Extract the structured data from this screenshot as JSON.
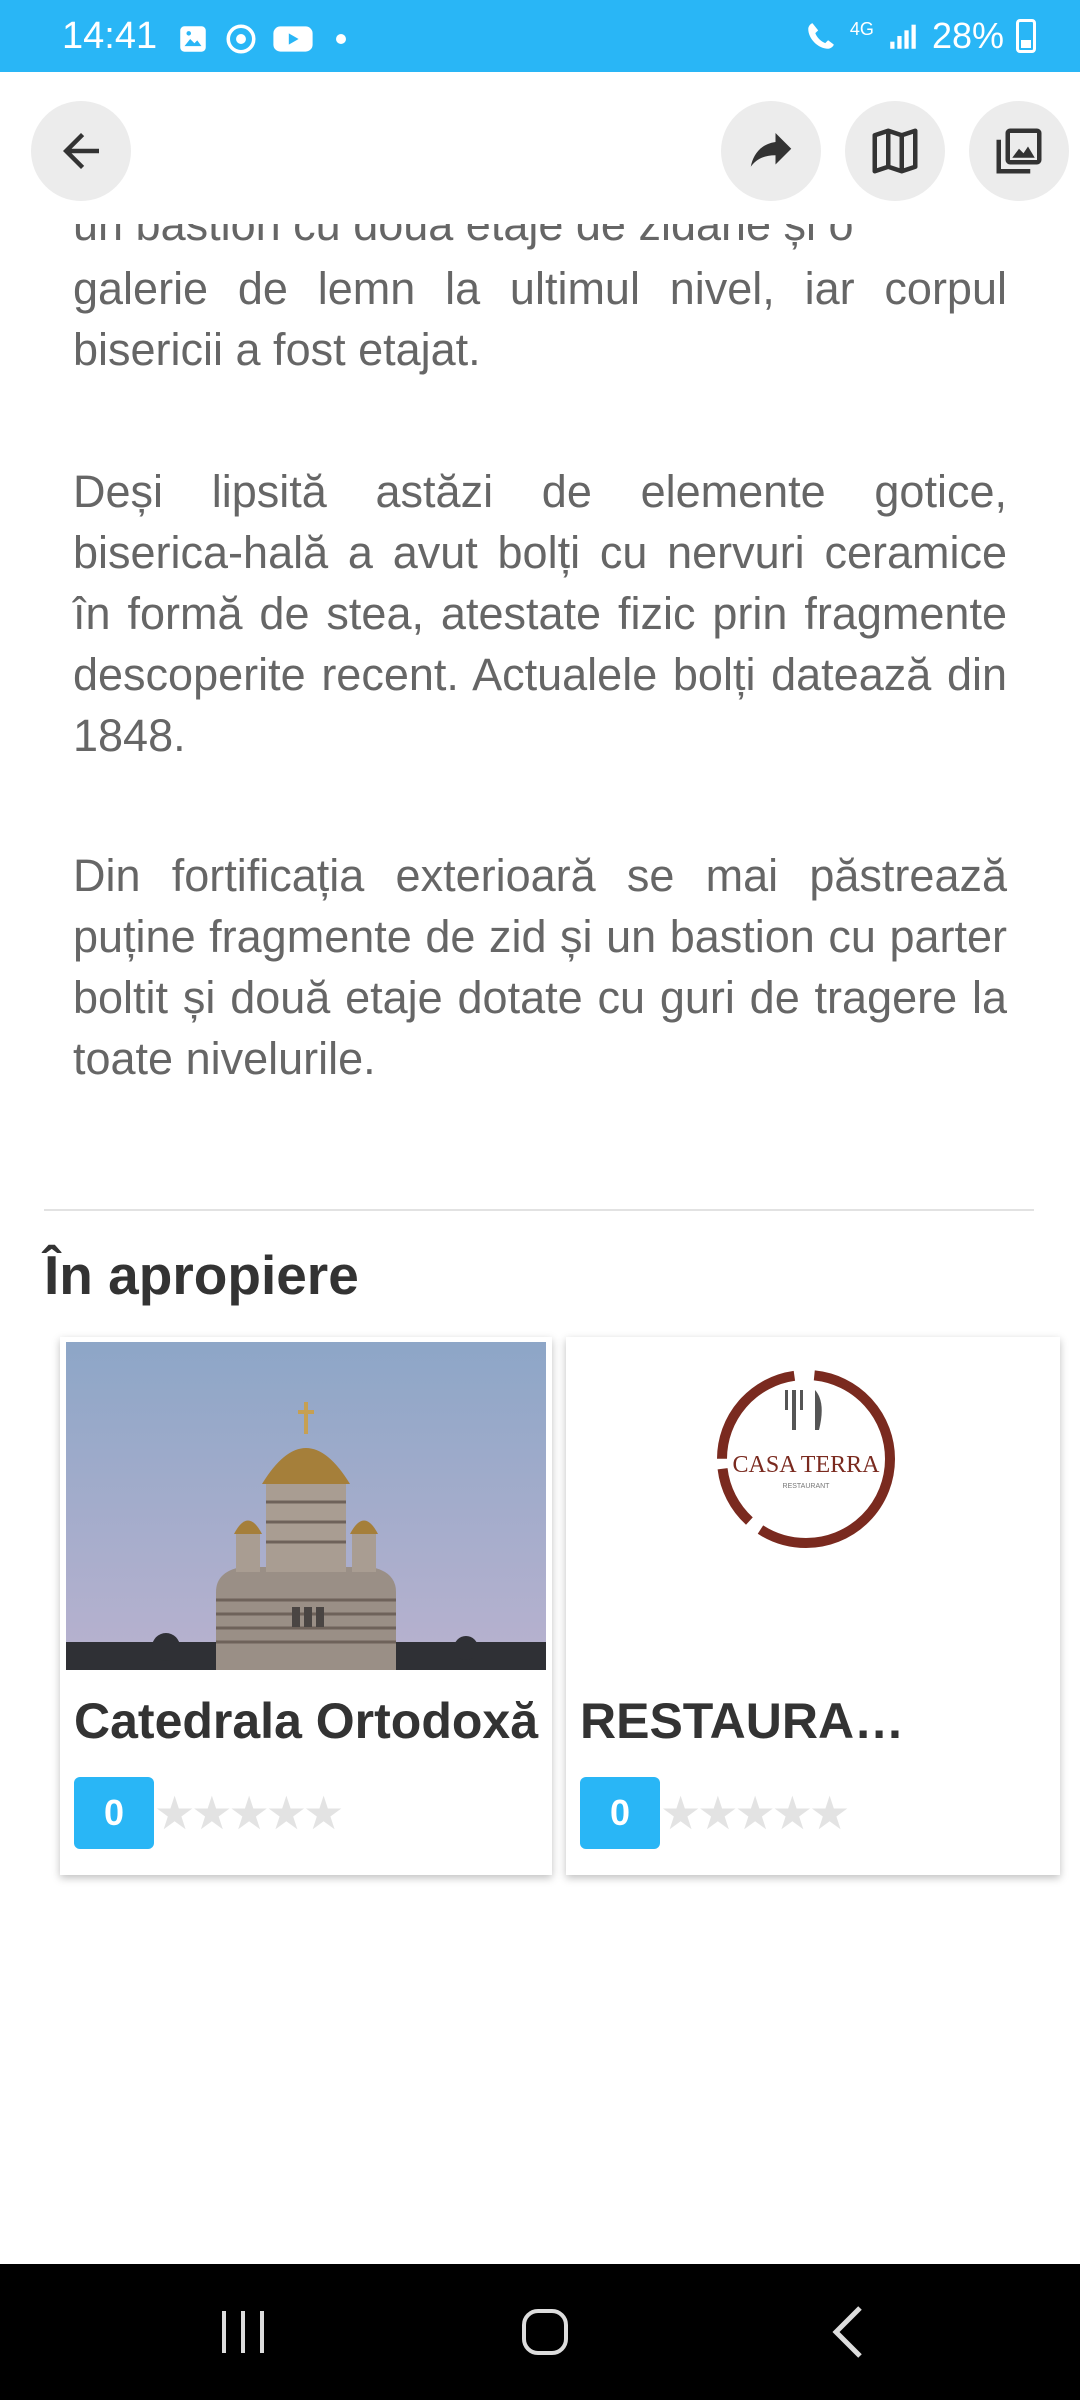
{
  "status_bar": {
    "time": "14:41",
    "network": "4G",
    "battery": "28%"
  },
  "toolbar": {
    "back": "back-arrow-icon",
    "share": "share-icon",
    "map": "map-icon",
    "gallery": "gallery-icon"
  },
  "article": {
    "partial_line": "un bastion cu două etaje de zidărie și o",
    "para1_rest": "galerie de lemn la ultimul nivel, iar corpul bisericii a fost etajat.",
    "para2": "Deși lipsită astăzi de elemente gotice, biserica-hală a avut bolți cu nervuri ceramice în formă de stea, atestate fizic prin fragmente descoperite recent. Actualele bolți datează din 1848.",
    "para3": "Din fortificația exterioară se mai păstrează puține fragmente de zid și un bastion cu parter boltit și două etaje dotate cu guri de tragere la toate nivelurile."
  },
  "nearby": {
    "title": "În apropiere",
    "items": [
      {
        "name": "Catedrala Ortodoxă",
        "rating": "0",
        "stars": "★★★★★"
      },
      {
        "name": "RESTAURANT CASA TERRA",
        "rating": "0",
        "stars": "★★★★★",
        "logo_text": "CASA TERRA",
        "logo_sub": "RESTAURANT"
      }
    ]
  },
  "colors": {
    "accent": "#29b6f6",
    "text": "#666666",
    "heading": "#333333"
  }
}
